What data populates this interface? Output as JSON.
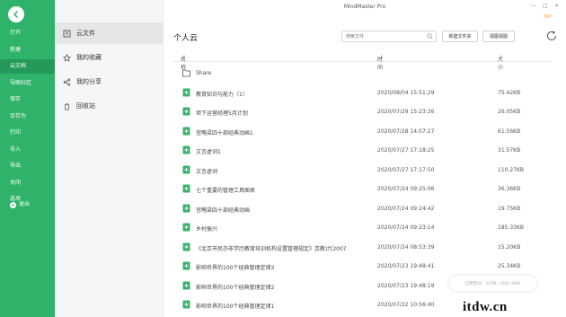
{
  "window": {
    "title": "MindMaster Pro",
    "user_badge": "TRY",
    "controls": [
      "—",
      "□",
      "×"
    ]
  },
  "leftbar": {
    "items": [
      {
        "label": "打开",
        "active": false
      },
      {
        "label": "新建",
        "active": false
      },
      {
        "label": "云文档",
        "active": true
      },
      {
        "label": "导图社区",
        "active": false
      },
      {
        "label": "保存",
        "active": false
      },
      {
        "label": "另存为",
        "active": false
      },
      {
        "label": "打印",
        "active": false
      },
      {
        "label": "导入",
        "active": false
      },
      {
        "label": "导出",
        "active": false
      },
      {
        "label": "关闭",
        "active": false
      },
      {
        "label": "选项",
        "active": false
      }
    ],
    "exit_label": "退出"
  },
  "navcol": {
    "items": [
      {
        "label": "云文件",
        "icon": "cloud-file-icon",
        "active": true
      },
      {
        "label": "我的收藏",
        "icon": "star-icon",
        "active": false
      },
      {
        "label": "我的分享",
        "icon": "share-icon",
        "active": false
      },
      {
        "label": "回收站",
        "icon": "trash-icon",
        "active": false
      }
    ]
  },
  "main": {
    "title": "个人云",
    "search_placeholder": "搜索文件",
    "new_folder_label": "新建文件夹",
    "layout_view_label": "视图视图",
    "columns": {
      "name": "名称",
      "time": "时间",
      "size": "大小"
    },
    "sort_marker": "⇕",
    "sort_active": "↓",
    "rows": [
      {
        "name": "Share",
        "time": "",
        "size": "",
        "type": "folder"
      },
      {
        "name": "教育知识与能力（1）",
        "time": "2020/08/04 15:51:29",
        "size": "75.42KB",
        "type": "file"
      },
      {
        "name": "项下运营经理5月计划",
        "time": "2020/07/29 15:23:26",
        "size": "26.05KB",
        "type": "file"
      },
      {
        "name": "宫略梁四十部经典动画1",
        "time": "2020/07/28 14:07:27",
        "size": "61.56KB",
        "type": "file"
      },
      {
        "name": "文言虚词1",
        "time": "2020/07/27 17:18:25",
        "size": "31.57KB",
        "type": "file"
      },
      {
        "name": "文言虚词",
        "time": "2020/07/27 17:17:50",
        "size": "110.27KB",
        "type": "file"
      },
      {
        "name": "七个重要的管理工具图表",
        "time": "2020/07/24 09:25:06",
        "size": "36.36KB",
        "type": "file"
      },
      {
        "name": "宫略梁四十部经典动画",
        "time": "2020/07/24 09:24:42",
        "size": "19.75KB",
        "type": "file"
      },
      {
        "name": "乡村振兴",
        "time": "2020/07/24 09:23:14",
        "size": "185.33KB",
        "type": "file"
      },
      {
        "name": "《北京市民办非学历教育培训机构设置管理规定》京教计[2007",
        "time": "2020/07/24 08:53:39",
        "size": "15.20KB",
        "type": "file"
      },
      {
        "name": "影响世界的100个经典管理定律3",
        "time": "2020/07/23 19:48:41",
        "size": "25.34KB",
        "type": "file"
      },
      {
        "name": "影响世界的100个经典管理定律2",
        "time": "2020/07/23 19:48:19",
        "size": "",
        "type": "file"
      },
      {
        "name": "影响世界的100个经典管理定律1",
        "time": "2020/07/22 10:56:40",
        "size": "",
        "type": "file"
      }
    ],
    "toast": "已用空间：335M / 2GB (SIM)"
  },
  "watermark": "itdw.cn",
  "colors": {
    "brand_green": "#2fb36a",
    "file_icon_green": "#38b36b"
  }
}
